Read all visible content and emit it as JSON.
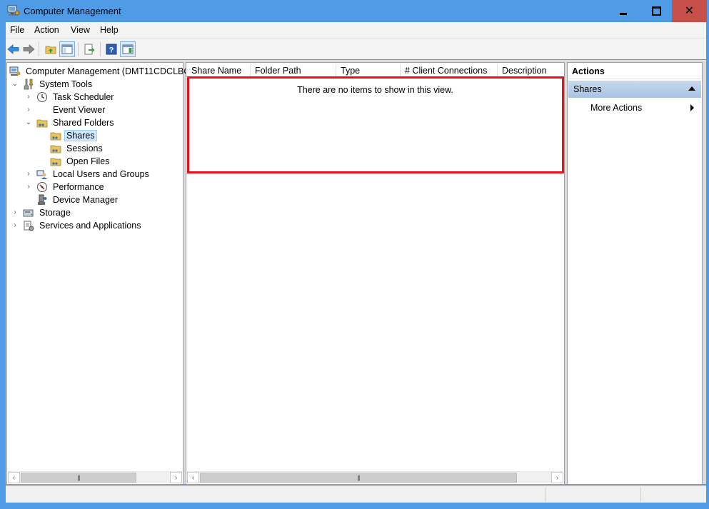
{
  "window": {
    "title": "Computer Management",
    "minimize_icon": "minimize-icon",
    "maximize_icon": "maximize-icon",
    "close_icon": "close-icon",
    "close_glyph": "✕",
    "close_color": "#c7504a"
  },
  "menu": {
    "items": [
      "File",
      "Action",
      "View",
      "Help"
    ]
  },
  "toolbar": {
    "icons": [
      "back-arrow-icon",
      "forward-arrow-icon",
      "up-folder-icon",
      "show-hide-console-tree-icon",
      "export-list-icon",
      "help-icon",
      "show-hide-action-pane-icon"
    ]
  },
  "tree": {
    "root": "Computer Management (DMT11CDCLBC",
    "items": [
      {
        "label": "System Tools",
        "expanded": true
      },
      {
        "label": "Task Scheduler"
      },
      {
        "label": "Event Viewer"
      },
      {
        "label": "Shared Folders",
        "expanded": true
      },
      {
        "label": "Shares",
        "selected": true
      },
      {
        "label": "Sessions"
      },
      {
        "label": "Open Files"
      },
      {
        "label": "Local Users and Groups"
      },
      {
        "label": "Performance"
      },
      {
        "label": "Device Manager"
      },
      {
        "label": "Storage"
      },
      {
        "label": "Services and Applications"
      }
    ]
  },
  "list": {
    "columns": [
      "Share Name",
      "Folder Path",
      "Type",
      "# Client Connections",
      "Description"
    ],
    "empty_message": "There are no items to show in this view.",
    "highlight_color": "#e8101b"
  },
  "actions": {
    "header": "Actions",
    "section": "Shares",
    "more_actions": "More Actions"
  },
  "colors": {
    "titlebar": "#4f9be6",
    "selection": "#cde8ff",
    "actions_section": "#b8cfe9"
  }
}
